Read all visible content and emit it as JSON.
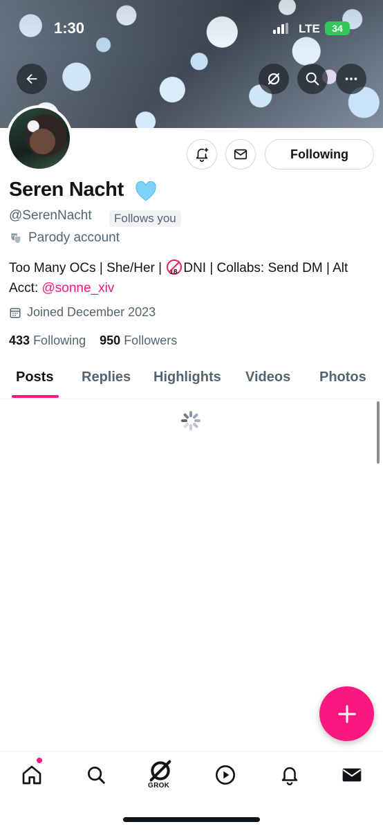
{
  "status_bar": {
    "time": "1:30",
    "network": "LTE",
    "battery": "34"
  },
  "profile": {
    "display_name": "Seren Nacht",
    "handle": "@SerenNacht",
    "follows_you": "Follows you",
    "parody_label": "Parody account",
    "bio_part1": "Too Many OCs | She/Her | ",
    "bio_ban_glyph": "18",
    "bio_part2": "DNI | Collabs: Send DM | Alt Acct: ",
    "bio_mention": "@sonne_xiv",
    "joined": "Joined December 2023",
    "following_count": "433",
    "following_label": "Following",
    "followers_count": "950",
    "followers_label": "Followers"
  },
  "actions": {
    "following_button": "Following"
  },
  "tabs": [
    {
      "label": "Posts",
      "active": true
    },
    {
      "label": "Replies",
      "active": false
    },
    {
      "label": "Highlights",
      "active": false
    },
    {
      "label": "Videos",
      "active": false
    },
    {
      "label": "Photos",
      "active": false
    }
  ],
  "bottom_nav": {
    "items": [
      "home-icon",
      "search-icon",
      "grok-icon",
      "video-icon",
      "notifications-icon",
      "messages-icon"
    ],
    "grok_label": "GROK"
  },
  "colors": {
    "accent": "#f91880",
    "text": "#0f1419",
    "secondary": "#536471",
    "heart": "#7dd3f5"
  }
}
